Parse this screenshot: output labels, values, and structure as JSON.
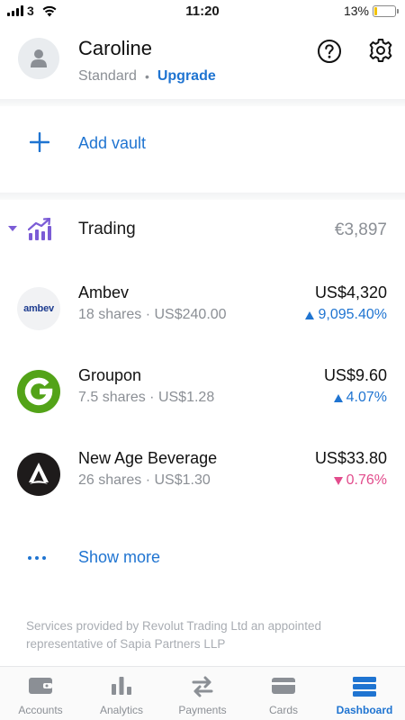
{
  "status_bar": {
    "carrier": "3",
    "time": "11:20",
    "battery_percent": "13%",
    "battery_level": 0.13
  },
  "user": {
    "name": "Caroline",
    "plan": "Standard",
    "separator": "•",
    "upgrade_label": "Upgrade"
  },
  "actions": {
    "add_vault_label": "Add vault"
  },
  "trading": {
    "title": "Trading",
    "total": "€3,897",
    "holdings": [
      {
        "name": "Ambev",
        "logo_text": "ambev",
        "shares_label": "18 shares",
        "price": "US$240.00",
        "value": "US$4,320",
        "change": "9,095.40%",
        "direction": "up"
      },
      {
        "name": "Groupon",
        "logo_text": "G",
        "shares_label": "7.5 shares",
        "price": "US$1.28",
        "value": "US$9.60",
        "change": "4.07%",
        "direction": "up"
      },
      {
        "name": "New Age Beverage",
        "logo_text": "",
        "shares_label": "26 shares",
        "price": "US$1.30",
        "value": "US$33.80",
        "change": "0.76%",
        "direction": "down"
      }
    ],
    "show_more_label": "Show more",
    "sub_separator": "·"
  },
  "disclaimer": "Services provided by Revolut Trading Ltd an appointed representative of Sapia Partners LLP",
  "tabs": [
    {
      "label": "Accounts",
      "icon": "wallet-icon",
      "active": false
    },
    {
      "label": "Analytics",
      "icon": "bar-chart-icon",
      "active": false
    },
    {
      "label": "Payments",
      "icon": "transfer-arrows-icon",
      "active": false
    },
    {
      "label": "Cards",
      "icon": "card-icon",
      "active": false
    },
    {
      "label": "Dashboard",
      "icon": "dashboard-icon",
      "active": true
    }
  ],
  "colors": {
    "accent": "#1f74d1",
    "negative": "#e24c8c",
    "trading_icon": "#7b5cd6",
    "groupon_green": "#53a318",
    "battery": "#f2c200"
  }
}
